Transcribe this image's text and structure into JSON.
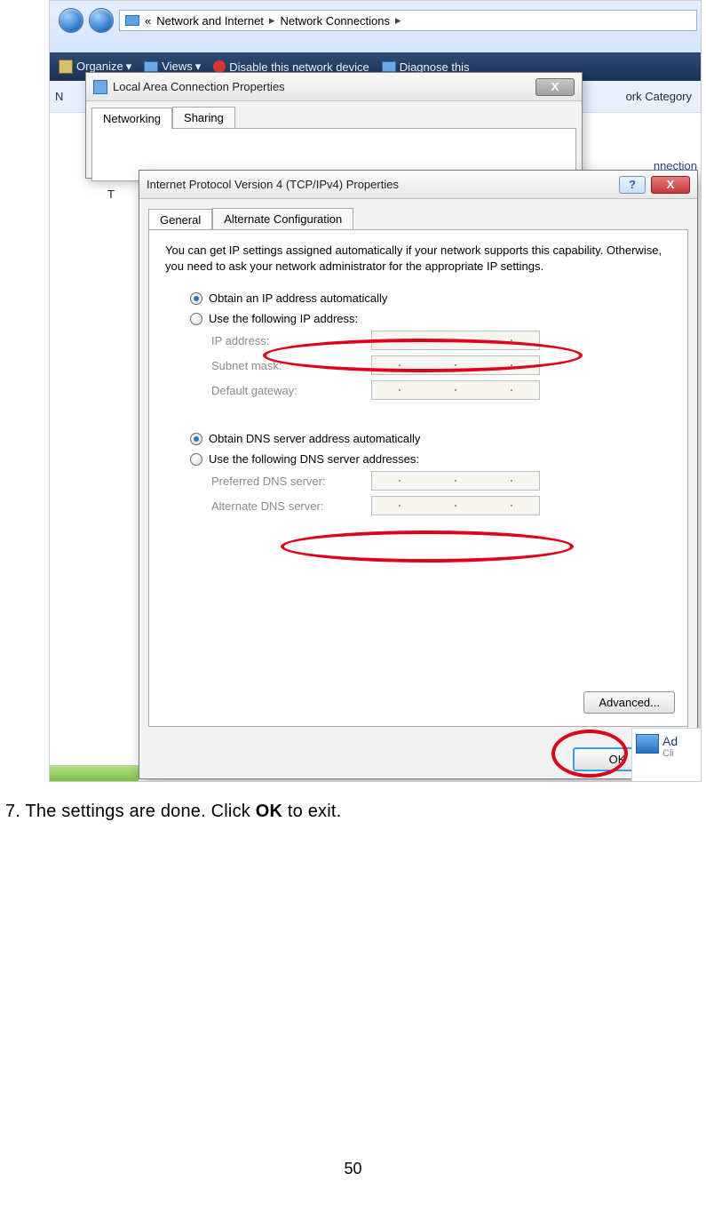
{
  "background_window": {
    "breadcrumb": {
      "chevron": "«",
      "part1": "Network and Internet",
      "sep": "▸",
      "part2": "Network Connections",
      "tail": "▸"
    },
    "toolbar": {
      "organize": "Organize",
      "views": "Views",
      "disable": "Disable this network device",
      "diagnose": "Diagnose this"
    },
    "header_right": "ork Category",
    "row_fragment_left": "N",
    "row_fragment_right": "nnection"
  },
  "dialog1": {
    "title": "Local Area Connection Properties",
    "tabs": {
      "networking": "Networking",
      "sharing": "Sharing"
    }
  },
  "dialog2": {
    "title": "Internet Protocol Version 4 (TCP/IPv4) Properties",
    "help": "?",
    "close": "X",
    "tabs": {
      "general": "General",
      "altconf": "Alternate Configuration"
    },
    "intro": "You can get IP settings assigned automatically if your network supports this capability. Otherwise, you need to ask your network administrator for the appropriate IP settings.",
    "radio": {
      "obtain_ip": "Obtain an IP address automatically",
      "use_ip": "Use the following IP address:",
      "obtain_dns": "Obtain DNS server address automatically",
      "use_dns": "Use the following DNS server addresses:"
    },
    "fields": {
      "ip_address": "IP address:",
      "subnet": "Subnet mask:",
      "gateway": "Default gateway:",
      "pref_dns": "Preferred DNS server:",
      "alt_dns": "Alternate DNS server:"
    },
    "advanced": "Advanced...",
    "ok": "OK"
  },
  "edge_fragment": {
    "title": "Ad",
    "sub": "Cli"
  },
  "caption": {
    "pre": "7. The settings are done. Click ",
    "bold": "OK",
    "post": " to exit."
  },
  "page_number": "50"
}
